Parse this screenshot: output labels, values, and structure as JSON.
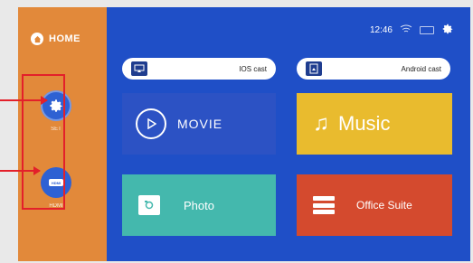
{
  "sidebar": {
    "home_label": "HOME",
    "settings_label": "SET",
    "hdmi_label": "HDMI",
    "hdmi_chip": "HDMI"
  },
  "status": {
    "time": "12:46"
  },
  "cast": {
    "ios_label": "IOS cast",
    "android_label": "Android cast"
  },
  "tiles": {
    "movie": "MOVIE",
    "music": "Music",
    "photo": "Photo",
    "office": "Office Suite"
  },
  "colors": {
    "sidebar": "#e2893a",
    "main": "#1f4fc7",
    "movie": "#2c52c4",
    "music": "#e9bb2e",
    "photo": "#44b8ad",
    "office": "#d44a2e",
    "highlight": "#e3202a"
  },
  "icons": [
    "home-icon",
    "gear-icon",
    "hdmi-icon",
    "wifi-icon",
    "battery-icon",
    "airplay-icon",
    "android-cast-icon",
    "play-icon",
    "music-note-icon",
    "photo-icon",
    "office-suite-icon"
  ]
}
